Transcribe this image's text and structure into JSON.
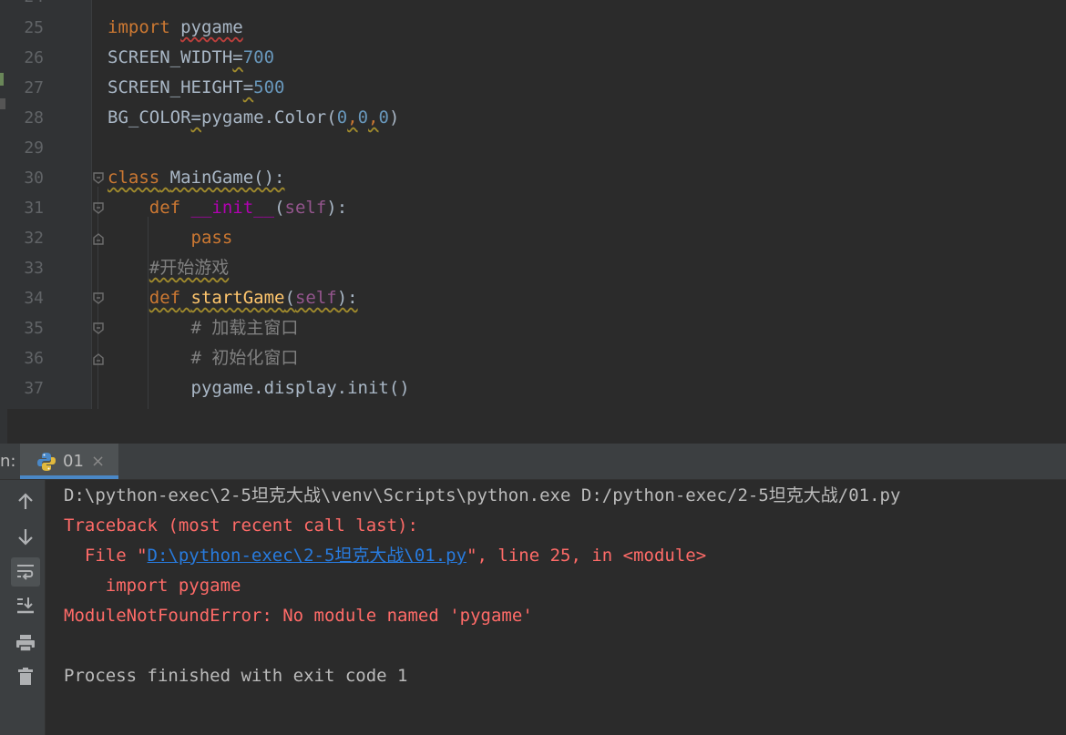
{
  "editor": {
    "top_partial_line": "24",
    "lines": [
      {
        "num": "25"
      },
      {
        "num": "26"
      },
      {
        "num": "27"
      },
      {
        "num": "28"
      },
      {
        "num": "29"
      },
      {
        "num": "30"
      },
      {
        "num": "31"
      },
      {
        "num": "32"
      },
      {
        "num": "33"
      },
      {
        "num": "34"
      },
      {
        "num": "35"
      },
      {
        "num": "36"
      },
      {
        "num": "37"
      }
    ],
    "code": {
      "l25_kw": "import",
      "l25_mod": "pygame",
      "l26_name": "SCREEN_WIDTH",
      "l26_eq": "=",
      "l26_val": "700",
      "l27_name": "SCREEN_HEIGHT",
      "l27_eq": "=",
      "l27_val": "500",
      "l28_name": "BG_COLOR",
      "l28_eq": "=",
      "l28_call": "pygame.Color(",
      "l28_a": "0",
      "l28_c1": ",",
      "l28_b": "0",
      "l28_c2": ",",
      "l28_c": "0",
      "l28_close": ")",
      "l30_kw": "class",
      "l30_name": "MainGame():",
      "l31_kw": "def",
      "l31_fn": "__init__",
      "l31_open": "(",
      "l31_self": "self",
      "l31_close": "):",
      "l32_kw": "pass",
      "l33_cmt": "#开始游戏",
      "l34_kw": "def",
      "l34_fn": "startGame",
      "l34_open": "(",
      "l34_self": "self",
      "l34_close": "):",
      "l35_cmt": "# 加载主窗口",
      "l36_cmt": "# 初始化窗口",
      "l37_code": "pygame.display.init()"
    }
  },
  "run_panel": {
    "label": "n:",
    "tab_label": "01",
    "tab_close": "×",
    "toolbar_icons": [
      "up-arrow-icon",
      "down-arrow-icon",
      "soft-wrap-icon",
      "scroll-to-end-icon",
      "print-icon",
      "trash-icon"
    ],
    "console": {
      "cmd": "D:\\python-exec\\2-5坦克大战\\venv\\Scripts\\python.exe D:/python-exec/2-5坦克大战/01.py",
      "traceback": "Traceback (most recent call last):",
      "file_prefix": "  File \"",
      "file_link": "D:\\python-exec\\2-5坦克大战\\01.py",
      "file_suffix": "\", line 25, in <module>",
      "import_line": "    import pygame",
      "error": "ModuleNotFoundError: No module named 'pygame'",
      "finished": "Process finished with exit code 1"
    }
  },
  "colors": {
    "background": "#2b2b2b",
    "keyword": "#cc7832",
    "number": "#6897bb",
    "error": "#ff6b68",
    "link": "#287bde",
    "tab_accent": "#4a88c7"
  }
}
